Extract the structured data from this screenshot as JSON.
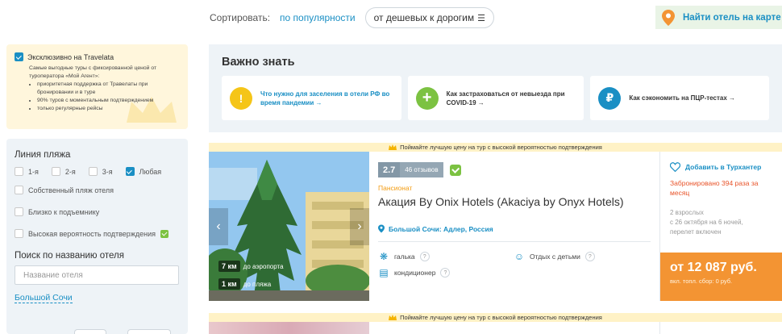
{
  "sort": {
    "label": "Сортировать:",
    "popularity": "по популярности",
    "price": "от дешевых к дорогим"
  },
  "map_button": {
    "label": "Найти отель на карте"
  },
  "exclusive": {
    "title": "Эксклюзивно на Travelata",
    "checked": true,
    "description": "Самые выгодные туры с фиксированной ценой от туроператора «Мой Агент»:",
    "bullets": [
      "приоритетная поддержка от Травелаты при бронировании и в туре",
      "90% туров с моментальным подтверждением",
      "только регулярные рейсы"
    ]
  },
  "filters": {
    "beach_line_title": "Линия пляжа",
    "beach_options": [
      {
        "label": "1-я",
        "checked": false
      },
      {
        "label": "2-я",
        "checked": false
      },
      {
        "label": "3-я",
        "checked": false
      },
      {
        "label": "Любая",
        "checked": true
      }
    ],
    "own_beach": "Собственный пляж отеля",
    "near_lift": "Близко к подъемнику",
    "high_confirmation": "Высокая вероятность подтверждения",
    "name_search_title": "Поиск по названию отеля",
    "name_placeholder": "Название отеля",
    "region_link": "Большой Сочи"
  },
  "important": {
    "title": "Важно знать",
    "cards": [
      {
        "icon": "!",
        "text": "Что нужно для заселения в отели РФ во время пандемии →",
        "color": "#f5c518",
        "text_color": "#1a8fc4"
      },
      {
        "icon": "+",
        "text": "Как застраховаться от невыезда при COVID-19 →",
        "color": "#7cc242",
        "text_color": "#333333"
      },
      {
        "icon": "₽",
        "text": "Как сэкономить на ПЦР-тестах →",
        "color": "#1a8fc4",
        "text_color": "#333333"
      }
    ]
  },
  "banner": {
    "text": "Поймайте лучшую цену на тур с высокой вероятностью подтверждения"
  },
  "hotel": {
    "score": "2.7",
    "reviews": "46 отзывов",
    "type": "Пансионат",
    "name": "Акация By Onix Hotels (Akaciya by Onyx Hotels)",
    "location": "Большой Сочи: Адлер, Россия",
    "distances": [
      {
        "km": "7 км",
        "label": "до аэропорта"
      },
      {
        "km": "1 км",
        "label": "до пляжа"
      }
    ],
    "features": [
      {
        "icon": "pebble-icon",
        "label": "галька"
      },
      {
        "icon": "child-icon",
        "label": "Отдых с детьми"
      },
      {
        "icon": "aircon-icon",
        "label": "кондиционер"
      }
    ],
    "favorite_label": "Добавить в Турхантер",
    "booked": "Забронировано 394 раза за месяц",
    "params": [
      "2 взрослых",
      "с 26 октября на 6 ночей,",
      "перелет включен"
    ],
    "price": "от 12 087 руб.",
    "price_note": "вкл. топл. сбор: 0 руб."
  },
  "colors": {
    "accent": "#1a8fc4",
    "price_bg": "#f39433",
    "ok_green": "#7cc242",
    "booked_red": "#e8542a"
  }
}
